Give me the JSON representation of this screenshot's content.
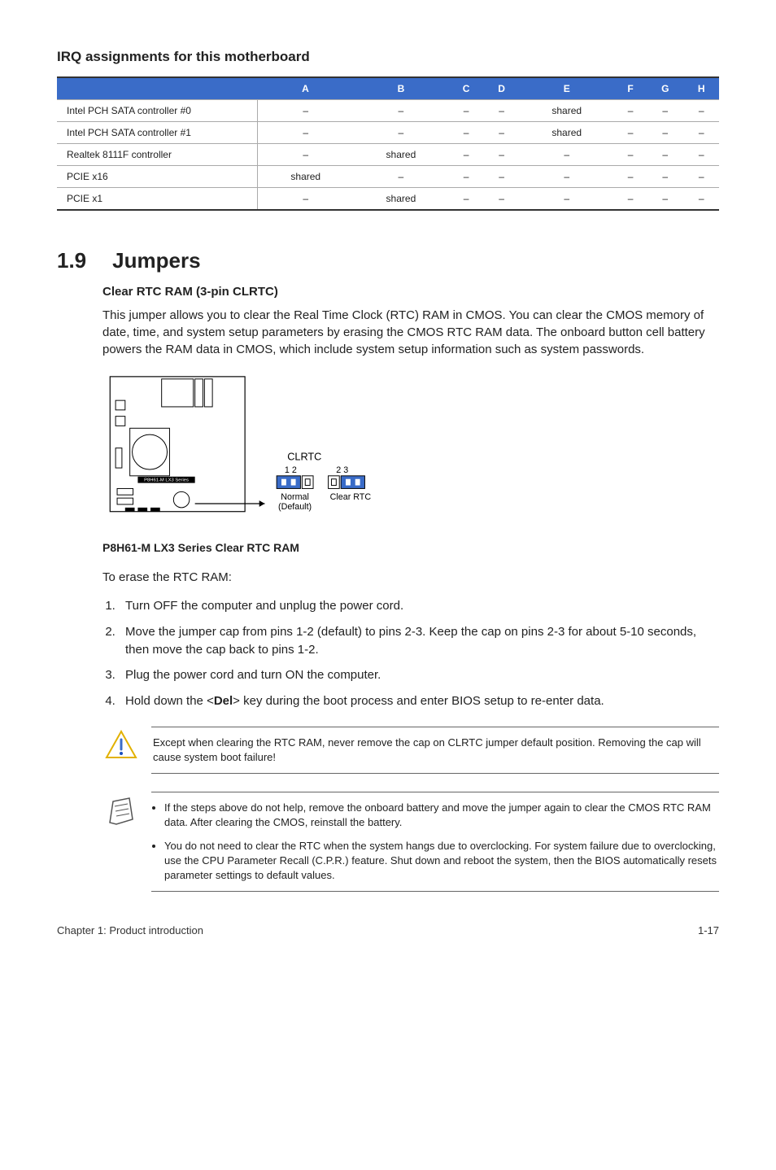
{
  "irq": {
    "heading": "IRQ assignments for this motherboard",
    "cols": [
      "",
      "A",
      "B",
      "C",
      "D",
      "E",
      "F",
      "G",
      "H"
    ],
    "rows": [
      {
        "label": "Intel PCH SATA controller #0",
        "cells": [
          "–",
          "–",
          "–",
          "–",
          "shared",
          "–",
          "–",
          "–"
        ]
      },
      {
        "label": "Intel PCH SATA controller #1",
        "cells": [
          "–",
          "–",
          "–",
          "–",
          "shared",
          "–",
          "–",
          "–"
        ]
      },
      {
        "label": "Realtek 8111F controller",
        "cells": [
          "–",
          "shared",
          "–",
          "–",
          "–",
          "–",
          "–",
          "–"
        ]
      },
      {
        "label": "PCIE x16",
        "cells": [
          "shared",
          "–",
          "–",
          "–",
          "–",
          "–",
          "–",
          "–"
        ]
      },
      {
        "label": "PCIE x1",
        "cells": [
          "–",
          "shared",
          "–",
          "–",
          "–",
          "–",
          "–",
          "–"
        ]
      }
    ]
  },
  "section": {
    "num": "1.9",
    "title": "Jumpers",
    "subtitle": "Clear RTC RAM (3-pin CLRTC)",
    "para": "This jumper allows you to clear the Real Time Clock (RTC) RAM in CMOS. You can clear the CMOS memory of date, time, and system setup parameters by erasing the CMOS RTC RAM data. The onboard button cell battery powers the RAM data in CMOS, which include system setup information such as system passwords.",
    "diagram": {
      "jumper_title": "CLRTC",
      "pins_normal": "1  2",
      "pins_clear": "2  3",
      "label_normal_top": "Normal",
      "label_normal_bot": "(Default)",
      "label_clear": "Clear RTC",
      "board_label": "P8H61-M LX3 Series",
      "caption": "P8H61-M LX3 Series Clear RTC RAM"
    },
    "erase_intro": "To erase the RTC RAM:",
    "steps": [
      "Turn OFF the computer and unplug the power cord.",
      "Move the jumper cap from pins 1-2 (default) to pins 2-3. Keep the cap on pins 2-3 for about 5-10 seconds, then move the cap back to pins 1-2.",
      "Plug the power cord and turn ON the computer.",
      "Hold down the <__DEL__> key during the boot process and enter BIOS setup to re-enter data."
    ],
    "del_key": "Del"
  },
  "callouts": {
    "warning": "Except when clearing the RTC RAM, never remove the cap on CLRTC jumper default position. Removing the cap will cause system boot failure!",
    "notes": [
      "If the steps above do not help, remove the onboard battery and move the jumper again to clear the CMOS RTC RAM data. After clearing the CMOS, reinstall the battery.",
      "You do not need to clear the RTC when the system hangs due to overclocking. For system failure due to overclocking, use the CPU Parameter Recall (C.P.R.) feature. Shut down and reboot the system, then the BIOS automatically resets parameter settings to default values."
    ]
  },
  "footer": {
    "left": "Chapter 1: Product introduction",
    "right": "1-17"
  }
}
